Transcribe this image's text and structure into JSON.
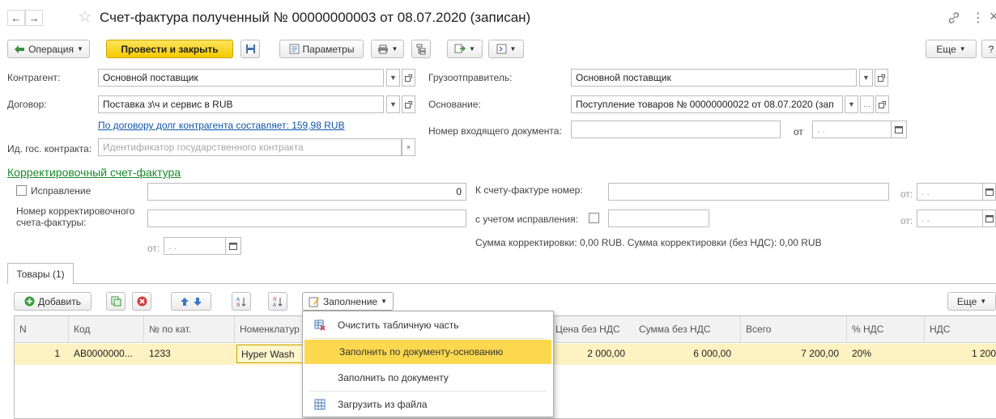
{
  "window": {
    "title": "Счет-фактура полученный № 00000000003 от 08.07.2020 (записан)",
    "back_glyph": "←",
    "forward_glyph": "→",
    "star_glyph": "☆",
    "link_glyph": "🔗",
    "more_glyph": "⋮",
    "close_glyph": "×"
  },
  "toolbar": {
    "operation_label": "Операция",
    "post_close_label": "Провести и закрыть",
    "params_label": "Параметры",
    "more_label": "Еще",
    "help_label": "?"
  },
  "form": {
    "kontragent_label": "Контрагент:",
    "kontragent_value": "Основной поставщик",
    "gruzootpr_label": "Грузоотправитель:",
    "gruzootpr_value": "Основной поставщик",
    "dogovor_label": "Договор:",
    "dogovor_value": "Поставка з\\ч и сервис в RUB",
    "osnovanie_label": "Основание:",
    "osnovanie_value": "Поступление товаров № 00000000022 от 08.07.2020 (зап",
    "debt_link": "По договору долг контрагента составляет: 159,98 RUB",
    "incoming_num_label": "Номер входящего документа:",
    "incoming_num_value": "",
    "ot_label": "от",
    "date_placeholder": " .  .",
    "gos_label": "Ид. гос. контракта:",
    "gos_placeholder": "Идентификатор государственного контракта"
  },
  "correction": {
    "section_title": "Корректировочный счет-фактура",
    "ispravlenie_label": "Исправление",
    "ispravlenie_value": "0",
    "nomer_label_1": "Номер корректировочного",
    "nomer_label_2": "счета-фактуры:",
    "k_schetu_label": "К счету-фактуре номер:",
    "s_uchetom_label": "с учетом исправления:",
    "ot_label": "от:",
    "summary": "Сумма корректировки: 0,00 RUB. Сумма корректировки (без НДС): 0,00 RUB"
  },
  "tabs": [
    {
      "label": "Товары (1)"
    }
  ],
  "table_toolbar": {
    "add_label": "Добавить",
    "fill_label": "Заполнение",
    "more_label": "Еще"
  },
  "table": {
    "columns": [
      "N",
      "Код",
      "№ по кат.",
      "Номенклатур",
      "Цена без НДС",
      "Сумма без НДС",
      "Всего",
      "% НДС",
      "НДС"
    ],
    "rows": [
      {
        "n": "1",
        "code": "AB0000000...",
        "cat": "1233",
        "nomenclature": "Hyper Wash",
        "price": "2 000,00",
        "sum": "6 000,00",
        "total": "7 200,00",
        "vat_pct": "20%",
        "vat": "1 200"
      }
    ]
  },
  "fill_menu": {
    "items": [
      {
        "label": "Очистить табличную часть",
        "icon": "clear-table-icon"
      },
      {
        "label": "Заполнить по документу-основанию",
        "icon": ""
      },
      {
        "label": "Заполнить по документу",
        "icon": ""
      },
      {
        "label": "Загрузить из файла",
        "icon": "load-file-icon"
      }
    ],
    "highlight_color": "#fbd84e"
  },
  "colors": {
    "accent_yellow": "#f5c900",
    "link_blue": "#0f55a8",
    "section_green": "#1a8a2a",
    "row_highlight": "#fdf2c2"
  }
}
